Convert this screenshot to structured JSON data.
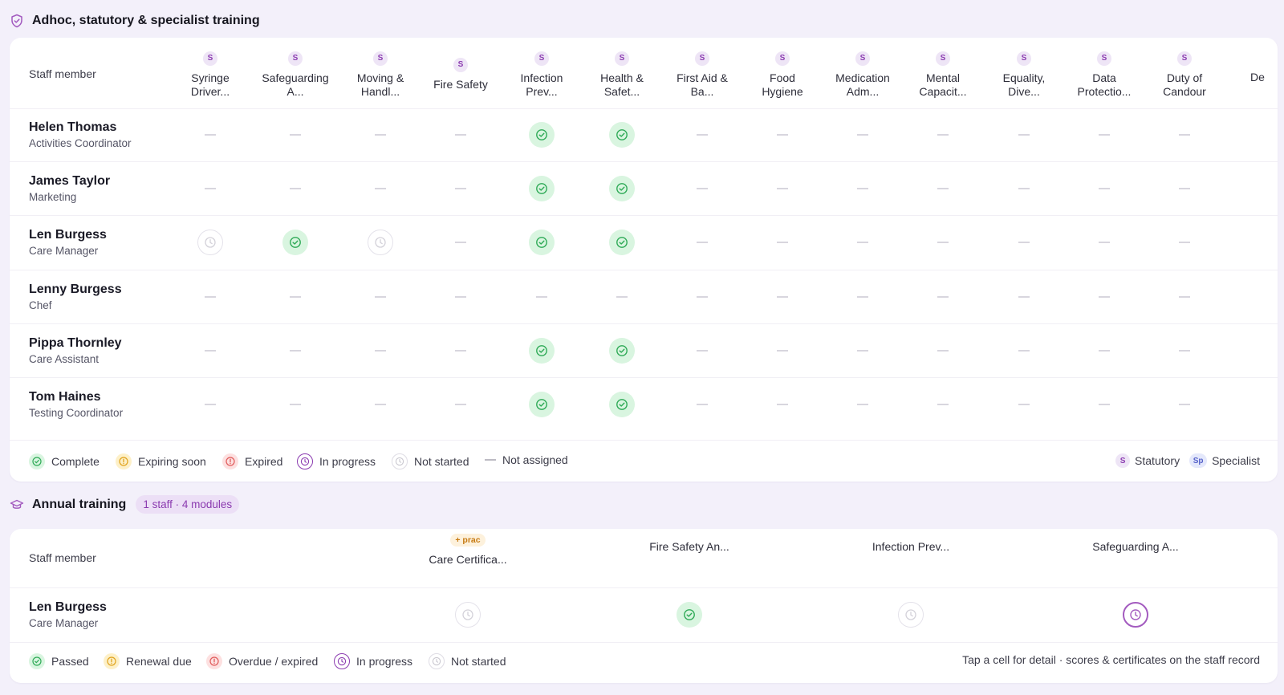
{
  "adhoc": {
    "title": "Adhoc, statutory & specialist training",
    "staff_header": "Staff member",
    "columns": [
      {
        "badge": "S",
        "label_line1": "Syringe",
        "label_line2": "Driver..."
      },
      {
        "badge": "S",
        "label_line1": "Safeguarding",
        "label_line2": "A..."
      },
      {
        "badge": "S",
        "label_line1": "Moving &",
        "label_line2": "Handl..."
      },
      {
        "badge": "S",
        "label_line1": "Fire Safety",
        "label_line2": ""
      },
      {
        "badge": "S",
        "label_line1": "Infection",
        "label_line2": "Prev..."
      },
      {
        "badge": "S",
        "label_line1": "Health &",
        "label_line2": "Safet..."
      },
      {
        "badge": "S",
        "label_line1": "First Aid &",
        "label_line2": "Ba..."
      },
      {
        "badge": "S",
        "label_line1": "Food",
        "label_line2": "Hygiene"
      },
      {
        "badge": "S",
        "label_line1": "Medication",
        "label_line2": "Adm..."
      },
      {
        "badge": "S",
        "label_line1": "Mental",
        "label_line2": "Capacit..."
      },
      {
        "badge": "S",
        "label_line1": "Equality,",
        "label_line2": "Dive..."
      },
      {
        "badge": "S",
        "label_line1": "Data",
        "label_line2": "Protectio..."
      },
      {
        "badge": "S",
        "label_line1": "Duty of",
        "label_line2": "Candour"
      },
      {
        "badge": "",
        "label_line1": "De",
        "label_line2": ""
      }
    ],
    "rows": [
      {
        "name": "Helen Thomas",
        "role": "Activities Coordinator",
        "cells": [
          "none",
          "none",
          "none",
          "none",
          "complete",
          "complete",
          "none",
          "none",
          "none",
          "none",
          "none",
          "none",
          "none"
        ]
      },
      {
        "name": "James Taylor",
        "role": "Marketing",
        "cells": [
          "none",
          "none",
          "none",
          "none",
          "complete",
          "complete",
          "none",
          "none",
          "none",
          "none",
          "none",
          "none",
          "none"
        ]
      },
      {
        "name": "Len Burgess",
        "role": "Care Manager",
        "cells": [
          "not_started",
          "complete",
          "not_started",
          "none",
          "complete",
          "complete",
          "none",
          "none",
          "none",
          "none",
          "none",
          "none",
          "none"
        ]
      },
      {
        "name": "Lenny Burgess",
        "role": "Chef",
        "cells": [
          "none",
          "none",
          "none",
          "none",
          "none",
          "none",
          "none",
          "none",
          "none",
          "none",
          "none",
          "none",
          "none"
        ]
      },
      {
        "name": "Pippa Thornley",
        "role": "Care Assistant",
        "cells": [
          "none",
          "none",
          "none",
          "none",
          "complete",
          "complete",
          "none",
          "none",
          "none",
          "none",
          "none",
          "none",
          "none"
        ]
      },
      {
        "name": "Tom Haines",
        "role": "Testing Coordinator",
        "cells": [
          "none",
          "none",
          "none",
          "none",
          "complete",
          "complete",
          "none",
          "none",
          "none",
          "none",
          "none",
          "none",
          "none"
        ]
      }
    ],
    "legend": {
      "complete": "Complete",
      "expiring": "Expiring soon",
      "expired": "Expired",
      "in_progress": "In progress",
      "not_started": "Not started",
      "not_assigned": "Not assigned",
      "statutory_badge": "S",
      "statutory": "Statutory",
      "specialist_badge": "Sp",
      "specialist": "Specialist"
    }
  },
  "annual": {
    "title": "Annual training",
    "summary": "1 staff · 4 modules",
    "staff_header": "Staff member",
    "columns": [
      {
        "tag": "+ prac",
        "label": "Care Certifica..."
      },
      {
        "tag": "",
        "label": "Fire Safety An..."
      },
      {
        "tag": "",
        "label": "Infection Prev..."
      },
      {
        "tag": "",
        "label": "Safeguarding A..."
      }
    ],
    "rows": [
      {
        "name": "Len Burgess",
        "role": "Care Manager",
        "cells": [
          "not_started",
          "complete",
          "not_started",
          "in_progress"
        ]
      }
    ],
    "legend": {
      "passed": "Passed",
      "renewal_due": "Renewal due",
      "overdue": "Overdue / expired",
      "in_progress": "In progress",
      "not_started": "Not started",
      "note": "Tap a cell for detail · scores & certificates on the staff record"
    }
  },
  "colors": {
    "accent": "#8b3bb0",
    "complete": "#2eaa56",
    "complete_bg": "#d9f5e0",
    "expiring": "#e0a21a",
    "expired": "#e05a5a",
    "page_bg": "#f3f0fa"
  }
}
